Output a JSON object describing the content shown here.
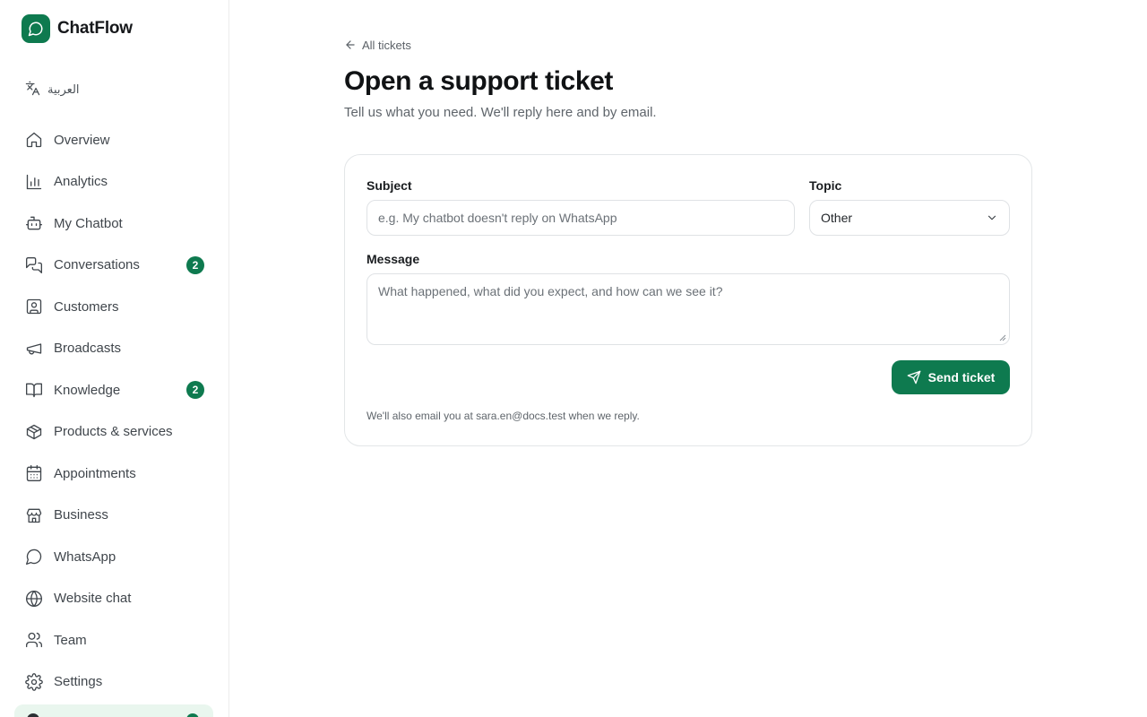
{
  "app": {
    "name": "ChatFlow",
    "logo_icon": "chat-bubble-icon",
    "accent": "#0e7a4f"
  },
  "language": {
    "label": "العربية",
    "icon": "translate-icon"
  },
  "sidebar": {
    "items": [
      {
        "label": "Overview",
        "icon": "home-icon"
      },
      {
        "label": "Analytics",
        "icon": "bar-chart-icon"
      },
      {
        "label": "My Chatbot",
        "icon": "bot-icon"
      },
      {
        "label": "Conversations",
        "icon": "messages-icon",
        "badge": "2"
      },
      {
        "label": "Customers",
        "icon": "contact-icon"
      },
      {
        "label": "Broadcasts",
        "icon": "megaphone-icon"
      },
      {
        "label": "Knowledge",
        "icon": "book-icon",
        "badge": "2"
      },
      {
        "label": "Products & services",
        "icon": "package-icon"
      },
      {
        "label": "Appointments",
        "icon": "calendar-icon"
      },
      {
        "label": "Business",
        "icon": "store-icon"
      },
      {
        "label": "WhatsApp",
        "icon": "chat-circle-icon"
      },
      {
        "label": "Website chat",
        "icon": "globe-icon"
      },
      {
        "label": "Team",
        "icon": "users-icon"
      },
      {
        "label": "Settings",
        "icon": "gear-icon"
      }
    ]
  },
  "page": {
    "back_label": "All tickets",
    "title": "Open a support ticket",
    "subtitle": "Tell us what you need. We'll reply here and by email."
  },
  "form": {
    "subject_label": "Subject",
    "subject_placeholder": "e.g. My chatbot doesn't reply on WhatsApp",
    "topic_label": "Topic",
    "topic_value": "Other",
    "message_label": "Message",
    "message_placeholder": "What happened, what did you expect, and how can we see it?",
    "send_label": "Send ticket",
    "footnote": "We'll also email you at sara.en@docs.test when we reply."
  }
}
